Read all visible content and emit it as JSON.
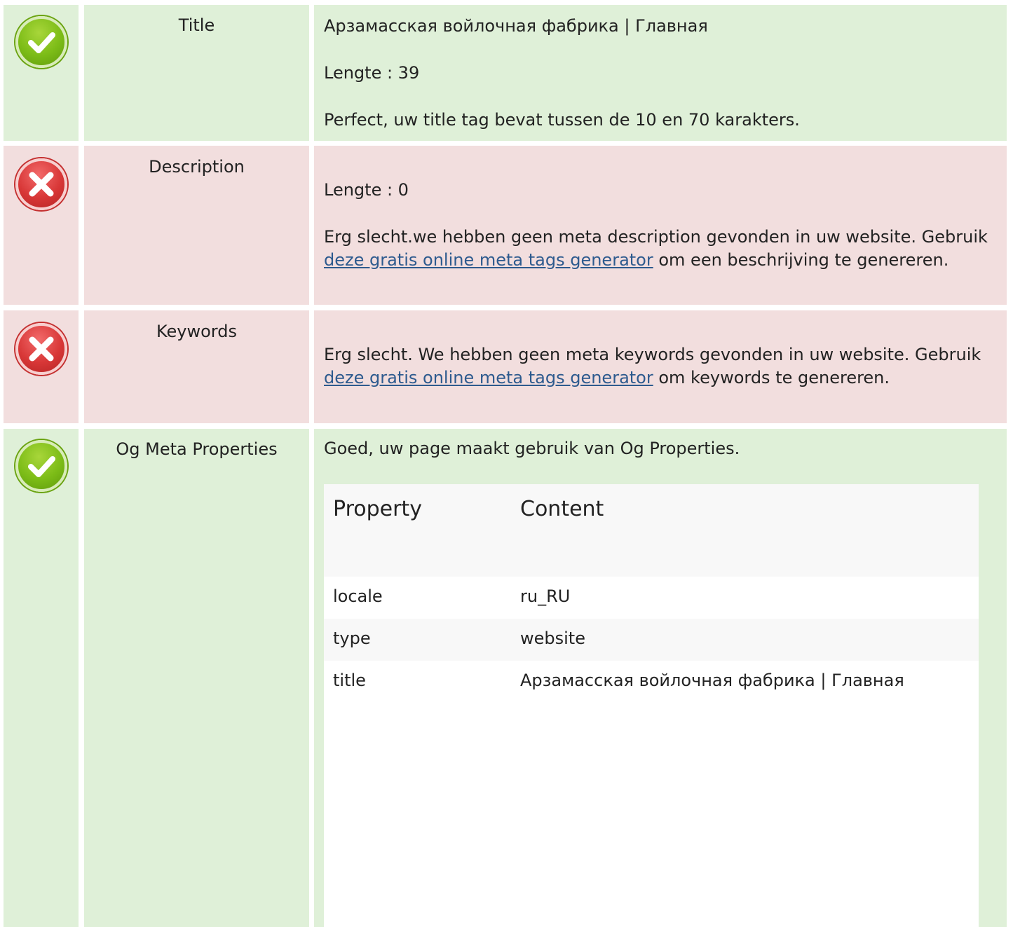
{
  "rows": {
    "title": {
      "label": "Title",
      "status": "ok",
      "value": "Арзамасская войлочная фабрика | Главная",
      "length": "Lengte : 39",
      "message": "Perfect, uw title tag bevat tussen de 10 en 70 karakters."
    },
    "description": {
      "label": "Description",
      "status": "bad",
      "length": "Lengte : 0",
      "message_pre": "Erg slecht.we hebben geen meta description gevonden in uw website. Gebruik ",
      "link": "deze gratis online meta tags generator",
      "message_post": " om een beschrijving te genereren."
    },
    "keywords": {
      "label": "Keywords",
      "status": "bad",
      "message_pre": "Erg slecht. We hebben geen meta keywords gevonden in uw website. Gebruik ",
      "link": "deze gratis online meta tags generator",
      "message_post": " om keywords te genereren."
    },
    "og": {
      "label": "Og Meta Properties",
      "status": "ok",
      "message": "Goed, uw page maakt gebruik van Og Properties.",
      "table": {
        "header_property": "Property",
        "header_content": "Content",
        "rows": [
          {
            "property": "locale",
            "content": "ru_RU"
          },
          {
            "property": "type",
            "content": "website"
          },
          {
            "property": "title",
            "content": "Арзамасская войлочная фабрика | Главная"
          }
        ]
      }
    }
  },
  "colors": {
    "ok_bg": "#dff0d8",
    "bad_bg": "#f2dede",
    "link": "#2d5a8e"
  },
  "icons": {
    "ok": "check-circle-icon",
    "bad": "x-circle-icon"
  }
}
